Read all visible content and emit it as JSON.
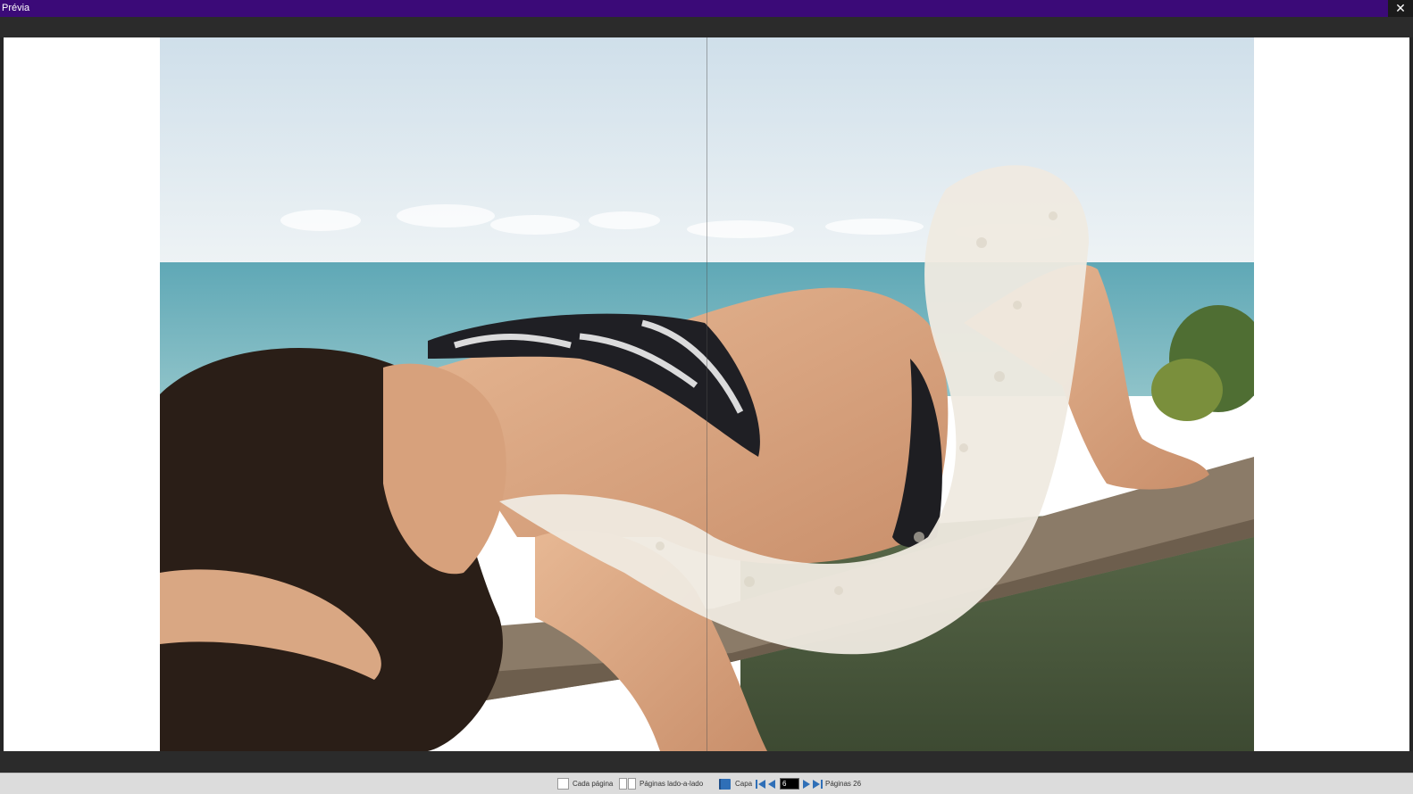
{
  "window": {
    "title": "Prévia",
    "close_label": "✕"
  },
  "toolbar": {
    "single_page_label": "Cada página",
    "side_by_side_label": "Páginas lado-a-lado",
    "cover_label": "Capa",
    "current_page": "6",
    "pages_label": "Páginas 26"
  },
  "colors": {
    "titlebar": "#3b0a78",
    "accent_nav": "#2f6fb7"
  },
  "icons": [
    "close-icon",
    "single-page-icon",
    "side-by-side-pages-icon",
    "cover-book-icon",
    "first-page-icon",
    "previous-page-icon",
    "next-page-icon",
    "last-page-icon"
  ]
}
